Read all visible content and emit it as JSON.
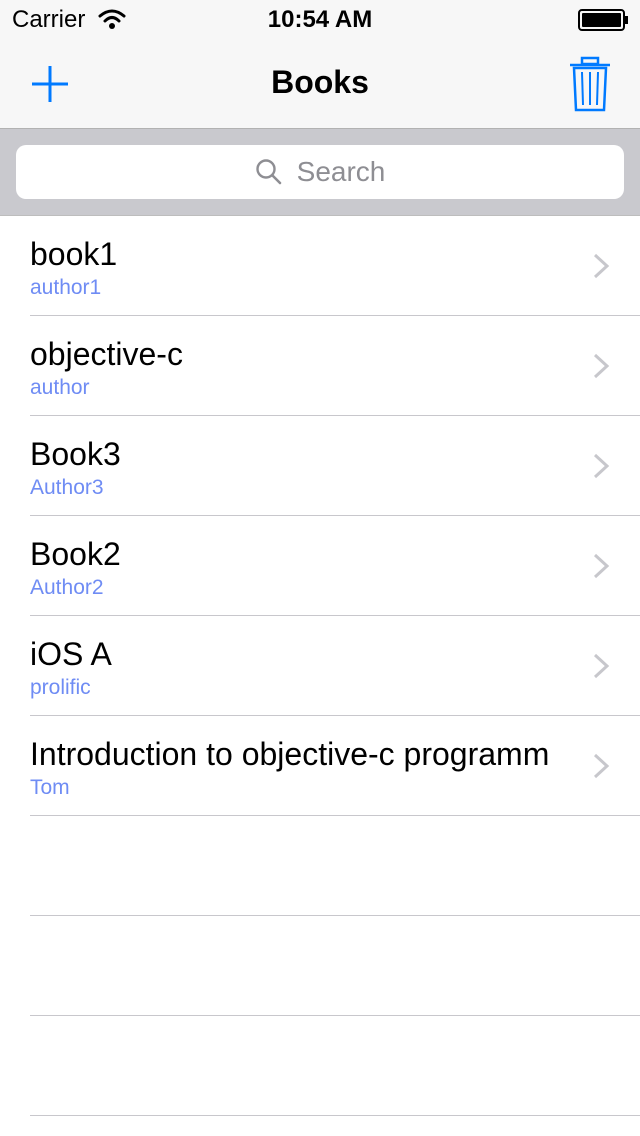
{
  "status_bar": {
    "carrier": "Carrier",
    "time": "10:54 AM"
  },
  "nav": {
    "title": "Books",
    "add_icon": "plus-icon",
    "trash_icon": "trash-icon"
  },
  "search": {
    "placeholder": "Search"
  },
  "books": [
    {
      "title": "book1",
      "author": "author1"
    },
    {
      "title": "objective-c",
      "author": "author"
    },
    {
      "title": "Book3",
      "author": "Author3"
    },
    {
      "title": "Book2",
      "author": "Author2"
    },
    {
      "title": "iOS A",
      "author": "prolific"
    },
    {
      "title": "Introduction to objective-c programm",
      "author": "Tom"
    }
  ],
  "colors": {
    "accent": "#007aff",
    "subtitle": "#6f8cf4",
    "separator": "#c8c7cc",
    "search_bar_bg": "#c9c9ce"
  }
}
